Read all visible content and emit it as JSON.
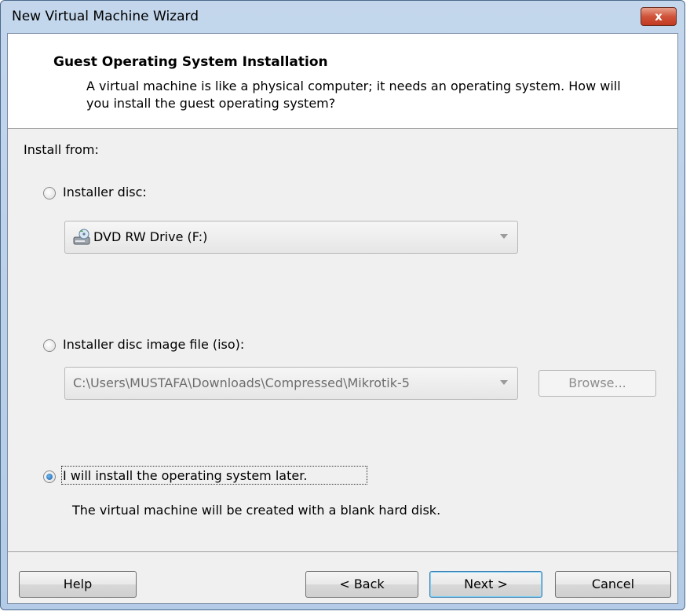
{
  "window": {
    "title": "New Virtual Machine Wizard",
    "close_label": "x"
  },
  "header": {
    "title": "Guest Operating System Installation",
    "description": "A virtual machine is like a physical computer; it needs an operating system. How will you install the guest operating system?"
  },
  "install_from_label": "Install from:",
  "options": {
    "disc": {
      "label": "Installer disc:",
      "selected": false,
      "drive_value": "DVD RW Drive (F:)"
    },
    "iso": {
      "label": "Installer disc image file (iso):",
      "selected": false,
      "path_value": "C:\\Users\\MUSTAFA\\Downloads\\Compressed\\Mikrotik-5",
      "browse_label": "Browse..."
    },
    "later": {
      "label": "I will install the operating system later.",
      "selected": true,
      "note": "The virtual machine will be created with a blank hard disk."
    }
  },
  "footer": {
    "help_label": "Help",
    "back_label": "< Back",
    "next_label": "Next >",
    "cancel_label": "Cancel"
  },
  "icons": {
    "close": "close-icon",
    "dvd": "dvd-drive-icon",
    "dropdown": "chevron-down-icon"
  },
  "colors": {
    "title_bar": "#c3d6ec",
    "close_button": "#c13a20",
    "dialog_bg": "#f0f0f0",
    "radio_selected": "#1d5fa8"
  }
}
